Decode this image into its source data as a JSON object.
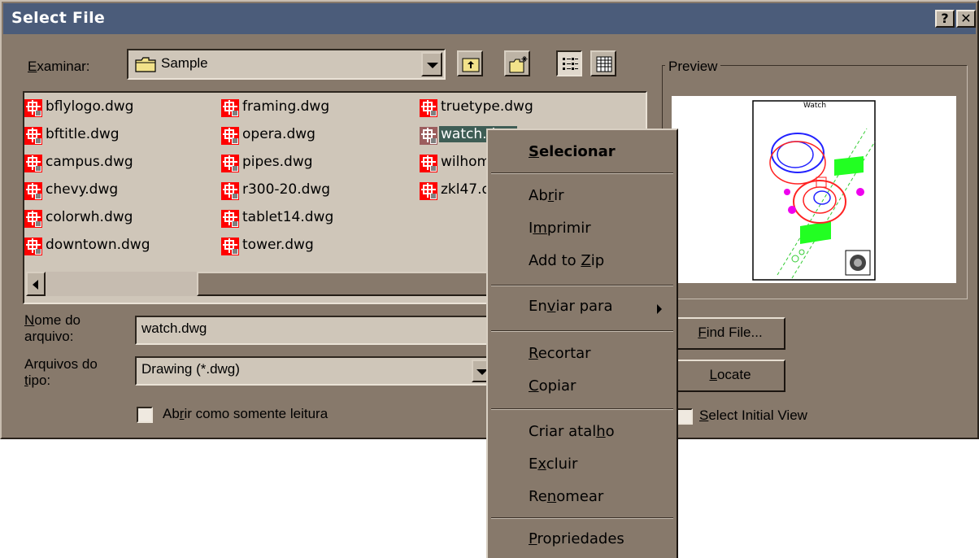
{
  "window": {
    "title": "Select File",
    "help_glyph": "?",
    "close_glyph": "✕"
  },
  "look_in": {
    "label_prefix": "E",
    "label_rest": "xaminar:",
    "value": "Sample"
  },
  "files": [
    {
      "name": "bflylogo.dwg",
      "col": 0,
      "row": 0
    },
    {
      "name": "bftitle.dwg",
      "col": 0,
      "row": 1
    },
    {
      "name": "campus.dwg",
      "col": 0,
      "row": 2
    },
    {
      "name": "chevy.dwg",
      "col": 0,
      "row": 3
    },
    {
      "name": "colorwh.dwg",
      "col": 0,
      "row": 4
    },
    {
      "name": "downtown.dwg",
      "col": 0,
      "row": 5
    },
    {
      "name": "framing.dwg",
      "col": 1,
      "row": 0
    },
    {
      "name": "opera.dwg",
      "col": 1,
      "row": 1
    },
    {
      "name": "pipes.dwg",
      "col": 1,
      "row": 2
    },
    {
      "name": "r300-20.dwg",
      "col": 1,
      "row": 3
    },
    {
      "name": "tablet14.dwg",
      "col": 1,
      "row": 4
    },
    {
      "name": "tower.dwg",
      "col": 1,
      "row": 5
    },
    {
      "name": "truetype.dwg",
      "col": 2,
      "row": 0
    },
    {
      "name": "watch.dwg",
      "col": 2,
      "row": 1,
      "selected": true
    },
    {
      "name": "wilhome.dwg",
      "col": 2,
      "row": 2
    },
    {
      "name": "zkl47.dwg",
      "col": 2,
      "row": 3
    }
  ],
  "filename": {
    "label_u": "N",
    "label_line1_rest": "ome do",
    "label_line2": "arquivo:",
    "value": "watch.dwg"
  },
  "filetype": {
    "label_line1": "Arquivos do",
    "label_u": "t",
    "label_line2_rest": "ipo:",
    "value": "Drawing (*.dwg)"
  },
  "readonly": {
    "pre": "Ab",
    "u": "r",
    "post": "ir como somente leitura",
    "checked": false
  },
  "preview": {
    "label": "Preview",
    "drawing_title": "Watch"
  },
  "buttons": {
    "find_u": "F",
    "find_rest": "ind File...",
    "locate_u": "L",
    "locate_rest": "ocate"
  },
  "select_initial_view": {
    "u": "S",
    "rest": "elect Initial View",
    "checked": false
  },
  "context_menu": [
    {
      "pre": "",
      "u": "S",
      "post": "elecionar",
      "bold": true
    },
    {
      "pre": "Ab",
      "u": "r",
      "post": "ir"
    },
    {
      "pre": "I",
      "u": "m",
      "post": "primir"
    },
    {
      "pre": "Add to ",
      "u": "Z",
      "post": "ip"
    },
    {
      "pre": "En",
      "u": "v",
      "post": "iar para",
      "submenu": true
    },
    {
      "pre": "",
      "u": "R",
      "post": "ecortar"
    },
    {
      "pre": "",
      "u": "C",
      "post": "opiar"
    },
    {
      "pre": "Criar atal",
      "u": "h",
      "post": "o"
    },
    {
      "pre": "E",
      "u": "x",
      "post": "cluir"
    },
    {
      "pre": "Re",
      "u": "n",
      "post": "omear"
    },
    {
      "pre": "",
      "u": "P",
      "post": "ropriedades"
    }
  ],
  "colors": {
    "face": "#87796b",
    "title": "#4b5c7a",
    "field": "#cfc6b9",
    "selection": "#3e5d55",
    "file_icon": "#ff0000"
  }
}
